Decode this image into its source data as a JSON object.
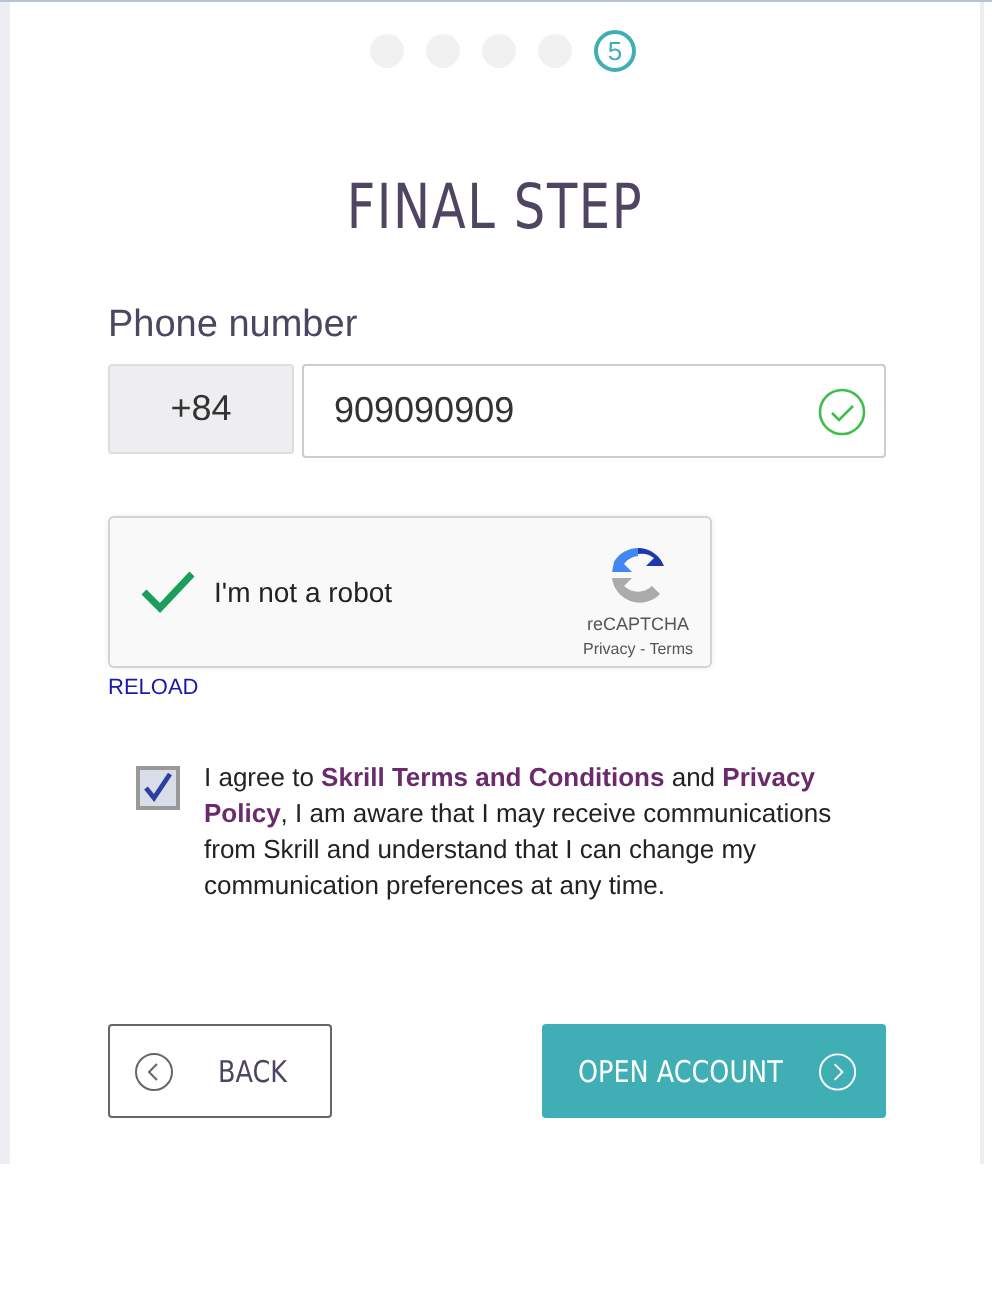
{
  "steps": [
    {
      "selected": false
    },
    {
      "selected": false
    },
    {
      "selected": false
    },
    {
      "selected": false
    },
    {
      "label": "5",
      "selected": true
    }
  ],
  "title": "FINAL STEP",
  "phone": {
    "label": "Phone number",
    "prefix": "+84",
    "value": "909090909",
    "valid": true
  },
  "captcha": {
    "label": "I'm not a robot",
    "checked": true,
    "brand": "reCAPTCHA",
    "links": "Privacy - Terms",
    "reload": "RELOAD"
  },
  "agreement": {
    "checked": true,
    "text": "I agree to **Skrill Terms and Conditions** and **Privacy Policy**, I am aware that I may receive communications from Skrill and understand that I can change my communication preferences at any time."
  },
  "buttons": [
    {
      "kind": "back",
      "label": "BACK"
    },
    {
      "kind": "next",
      "label": "OPEN ACCOUNT"
    }
  ]
}
